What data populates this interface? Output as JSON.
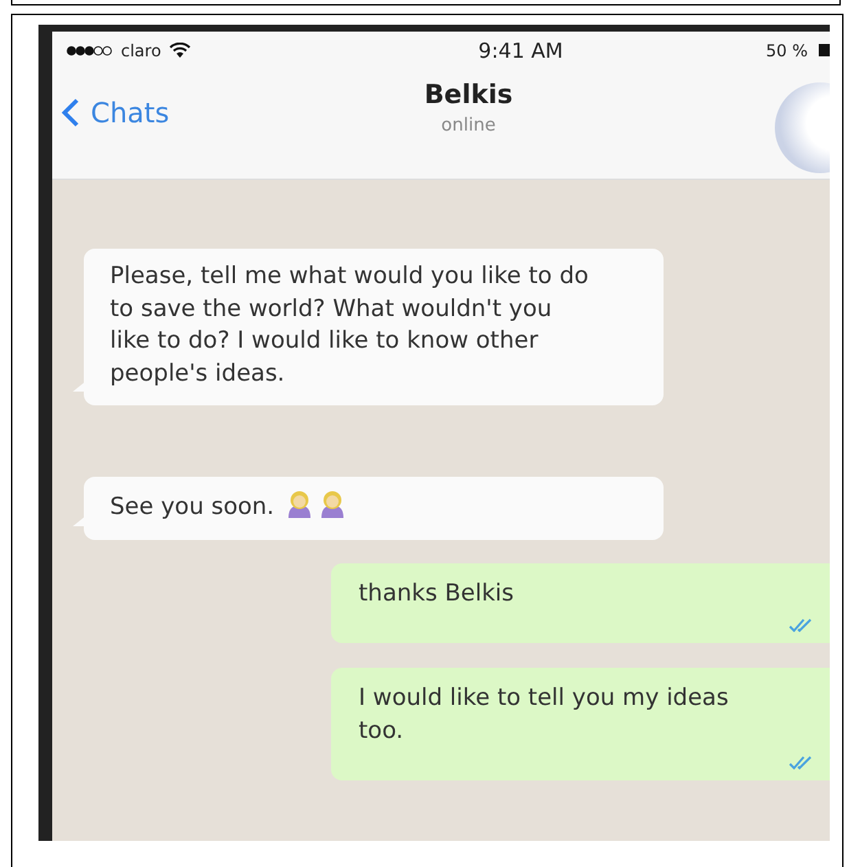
{
  "status_bar": {
    "carrier": "claro",
    "time": "9:41 AM",
    "battery": "50 %"
  },
  "nav": {
    "back": "Chats",
    "title": "Belkis",
    "subtitle": "online"
  },
  "messages": [
    {
      "kind": "incoming",
      "text": "Please, tell me what would you like to do to save the world? What wouldn't you like to do? I would like to know other people's ideas."
    },
    {
      "kind": "incoming",
      "text": "See you soon.",
      "emojis": [
        {
          "kind": "person"
        },
        {
          "kind": "person"
        }
      ]
    },
    {
      "kind": "outgoing",
      "text": "thanks Belkis",
      "read": true
    },
    {
      "kind": "outgoing",
      "text": "I would like to tell you my ideas too.",
      "read": true
    }
  ]
}
